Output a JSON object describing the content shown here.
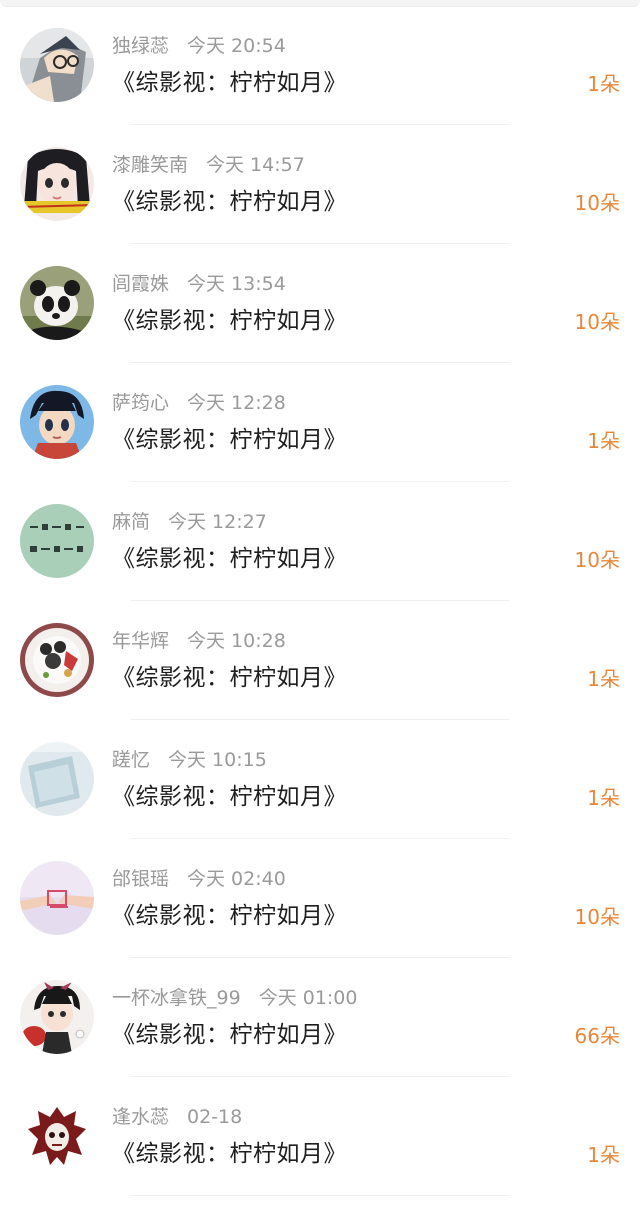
{
  "entries": [
    {
      "name": "独绿蕊",
      "time": "今天 20:54",
      "title": "《综影视：柠柠如月》",
      "count": "1朵",
      "avatar": "anime-boy-avatar"
    },
    {
      "name": "漆雕笑南",
      "time": "今天 14:57",
      "title": "《综影视：柠柠如月》",
      "count": "10朵",
      "avatar": "anime-girl-avatar"
    },
    {
      "name": "闾霞姝",
      "time": "今天 13:54",
      "title": "《综影视：柠柠如月》",
      "count": "10朵",
      "avatar": "panda-avatar"
    },
    {
      "name": "萨筠心",
      "time": "今天 12:28",
      "title": "《综影视：柠柠如月》",
      "count": "1朵",
      "avatar": "anime-character-avatar"
    },
    {
      "name": "麻简",
      "time": "今天 12:27",
      "title": "《综影视：柠柠如月》",
      "count": "10朵",
      "avatar": "calligraphy-avatar"
    },
    {
      "name": "年华辉",
      "time": "今天 10:28",
      "title": "《综影视：柠柠如月》",
      "count": "1朵",
      "avatar": "food-plate-avatar"
    },
    {
      "name": "蹉忆",
      "time": "今天 10:15",
      "title": "《综影视：柠柠如月》",
      "count": "1朵",
      "avatar": "pale-blue-avatar"
    },
    {
      "name": "邰银瑶",
      "time": "今天 02:40",
      "title": "《综影视：柠柠如月》",
      "count": "10朵",
      "avatar": "holding-hands-avatar"
    },
    {
      "name": "一杯冰拿铁_99",
      "time": "今天 01:00",
      "title": "《综影视：柠柠如月》",
      "count": "66朵",
      "avatar": "anime-pingpong-avatar"
    },
    {
      "name": "逢水蕊",
      "time": "02-18",
      "title": "《综影视：柠柠如月》",
      "count": "1朵",
      "avatar": "mascot-logo-avatar"
    }
  ],
  "colors": {
    "name": "#9a9a9a",
    "title": "#1e1e1e",
    "count": "#e8873a",
    "divider": "#f0f0f0"
  }
}
